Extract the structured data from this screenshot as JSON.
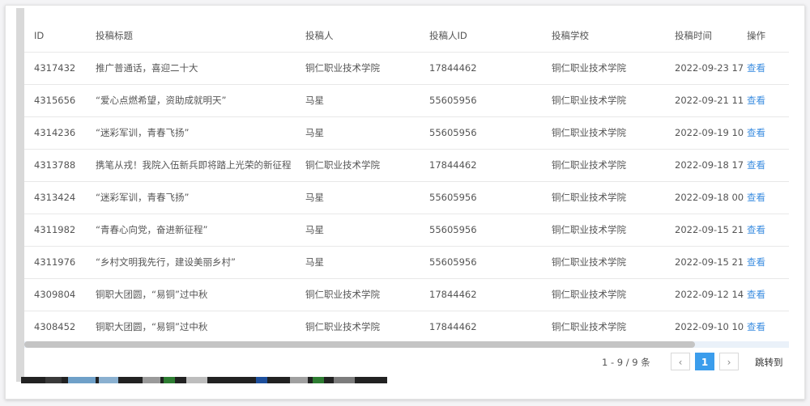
{
  "table": {
    "columns": [
      "ID",
      "投稿标题",
      "投稿人",
      "投稿人ID",
      "投稿学校",
      "投稿时间",
      "操作"
    ],
    "rows": [
      {
        "id": "4317432",
        "title": "推广普通话，喜迎二十大",
        "author": "铜仁职业技术学院",
        "author_id": "17844462",
        "school": "铜仁职业技术学院",
        "time": "2022-09-23 17",
        "action": "查看"
      },
      {
        "id": "4315656",
        "title": "“爱心点燃希望，资助成就明天”",
        "author": "马星",
        "author_id": "55605956",
        "school": "铜仁职业技术学院",
        "time": "2022-09-21 11",
        "action": "查看"
      },
      {
        "id": "4314236",
        "title": "“迷彩军训，青春飞扬”",
        "author": "马星",
        "author_id": "55605956",
        "school": "铜仁职业技术学院",
        "time": "2022-09-19 10",
        "action": "查看"
      },
      {
        "id": "4313788",
        "title": "携笔从戎！我院入伍新兵即将踏上光荣的新征程",
        "author": "铜仁职业技术学院",
        "author_id": "17844462",
        "school": "铜仁职业技术学院",
        "time": "2022-09-18 17",
        "action": "查看"
      },
      {
        "id": "4313424",
        "title": "“迷彩军训，青春飞扬”",
        "author": "马星",
        "author_id": "55605956",
        "school": "铜仁职业技术学院",
        "time": "2022-09-18 00",
        "action": "查看"
      },
      {
        "id": "4311982",
        "title": "“青春心向党，奋进新征程”",
        "author": "马星",
        "author_id": "55605956",
        "school": "铜仁职业技术学院",
        "time": "2022-09-15 21",
        "action": "查看"
      },
      {
        "id": "4311976",
        "title": "“乡村文明我先行，建设美丽乡村”",
        "author": "马星",
        "author_id": "55605956",
        "school": "铜仁职业技术学院",
        "time": "2022-09-15 21",
        "action": "查看"
      },
      {
        "id": "4309804",
        "title": "铜职大团圆，“易铜”过中秋",
        "author": "铜仁职业技术学院",
        "author_id": "17844462",
        "school": "铜仁职业技术学院",
        "time": "2022-09-12 14",
        "action": "查看"
      },
      {
        "id": "4308452",
        "title": "铜职大团圆，“易铜”过中秋",
        "author": "铜仁职业技术学院",
        "author_id": "17844462",
        "school": "铜仁职业技术学院",
        "time": "2022-09-10 10",
        "action": "查看"
      }
    ]
  },
  "pagination": {
    "info": "1 - 9 / 9 条",
    "prev_icon": "‹",
    "current_page": "1",
    "next_icon": "›",
    "jump_label": "跳转到"
  },
  "colors": {
    "link": "#3b8de0",
    "active_page": "#3b9dec",
    "scroll_track": "#eaf1f9"
  }
}
